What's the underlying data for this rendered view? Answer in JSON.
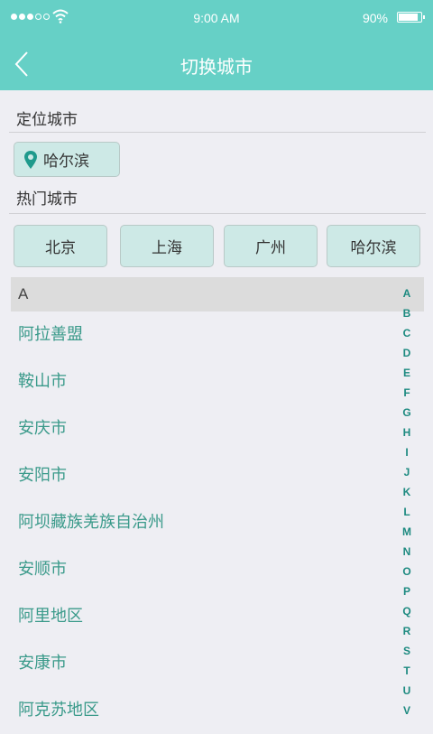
{
  "status_bar": {
    "time": "9:00 AM",
    "battery": "90%",
    "battery_level": 0.9,
    "signal_bars_filled": 3,
    "signal_bars_total": 5
  },
  "nav": {
    "title": "切换城市",
    "back_icon": "chevron-left-icon"
  },
  "location": {
    "section_label": "定位城市",
    "city": "哈尔滨",
    "icon": "map-pin-icon"
  },
  "hot": {
    "section_label": "热门城市",
    "cities": [
      "北京",
      "上海",
      "广州",
      "哈尔滨"
    ]
  },
  "list": {
    "current_letter": "A",
    "cities": [
      "阿拉善盟",
      "鞍山市",
      "安庆市",
      "安阳市",
      "阿坝藏族羌族自治州",
      "安顺市",
      "阿里地区",
      "安康市",
      "阿克苏地区"
    ]
  },
  "index_letters": [
    "A",
    "B",
    "C",
    "D",
    "E",
    "F",
    "G",
    "H",
    "I",
    "J",
    "K",
    "L",
    "M",
    "N",
    "O",
    "P",
    "Q",
    "R",
    "S",
    "T",
    "U",
    "V"
  ],
  "colors": {
    "accent": "#66d0c6",
    "city_text": "#3a9a8a",
    "chip_bg": "#cde9e6"
  }
}
